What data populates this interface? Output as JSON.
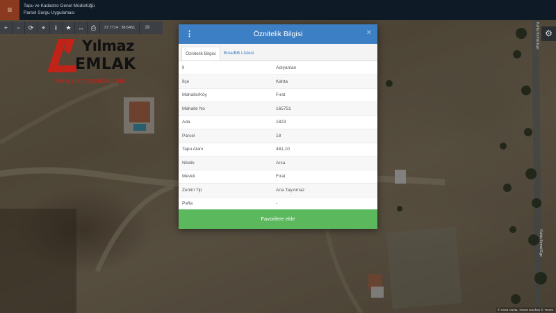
{
  "header": {
    "org_line": "Tapu ve Kadastro Genel Müdürlüğü",
    "app_line": "Parsel Sorgu Uygulaması",
    "menu_icon": "hamburger-icon"
  },
  "toolbar": {
    "buttons": [
      {
        "name": "zoom-in-icon",
        "glyph": "+"
      },
      {
        "name": "zoom-out-icon",
        "glyph": "−"
      },
      {
        "name": "refresh-icon",
        "glyph": "⟳"
      },
      {
        "name": "locate-icon",
        "glyph": "⌖"
      },
      {
        "name": "info-icon",
        "glyph": "i"
      },
      {
        "name": "star-icon",
        "glyph": "★"
      },
      {
        "name": "measure-icon",
        "glyph": "↔"
      },
      {
        "name": "print-icon",
        "glyph": "⎙"
      }
    ],
    "coords": "37.7714 : 38.6451",
    "zoom": "19"
  },
  "logo": {
    "brand_top": "Yılmaz",
    "brand_bottom": "EMLAK",
    "url": "www.yilmazemlak.com"
  },
  "map": {
    "road_label_1": "Kahta Kemal Ege",
    "road_label_2": "Kahta Kemal Ege",
    "attribution": "© HGM Harita, TKGM Ortofoto © TKGM"
  },
  "modal": {
    "title": "Öznitelik Bilgisi",
    "close_glyph": "✕",
    "tabs": [
      "Öznitelik Bilgisi",
      "Bina/BB Listesi"
    ],
    "rows": [
      {
        "key": "İl",
        "value": "Adıyaman"
      },
      {
        "key": "İlçe",
        "value": "Kahta"
      },
      {
        "key": "Mahalle/Köy",
        "value": "Fırat"
      },
      {
        "key": "Mahalle No",
        "value": "165751"
      },
      {
        "key": "Ada",
        "value": "1823"
      },
      {
        "key": "Parsel",
        "value": "18"
      },
      {
        "key": "Tapu Alanı",
        "value": "481,10"
      },
      {
        "key": "Nitelik",
        "value": "Arsa"
      },
      {
        "key": "Mevkii",
        "value": "Fırat"
      },
      {
        "key": "Zemin Tip",
        "value": "Ana Taşınmaz"
      },
      {
        "key": "Pafta",
        "value": "-"
      }
    ],
    "favorite_button": "Favorilere ekle"
  },
  "colors": {
    "header_bg": "#0e1a26",
    "menu_accent": "#8a3a1e",
    "modal_header": "#3d7fc4",
    "favorite_green": "#5cb85c",
    "logo_red": "#c02418"
  }
}
